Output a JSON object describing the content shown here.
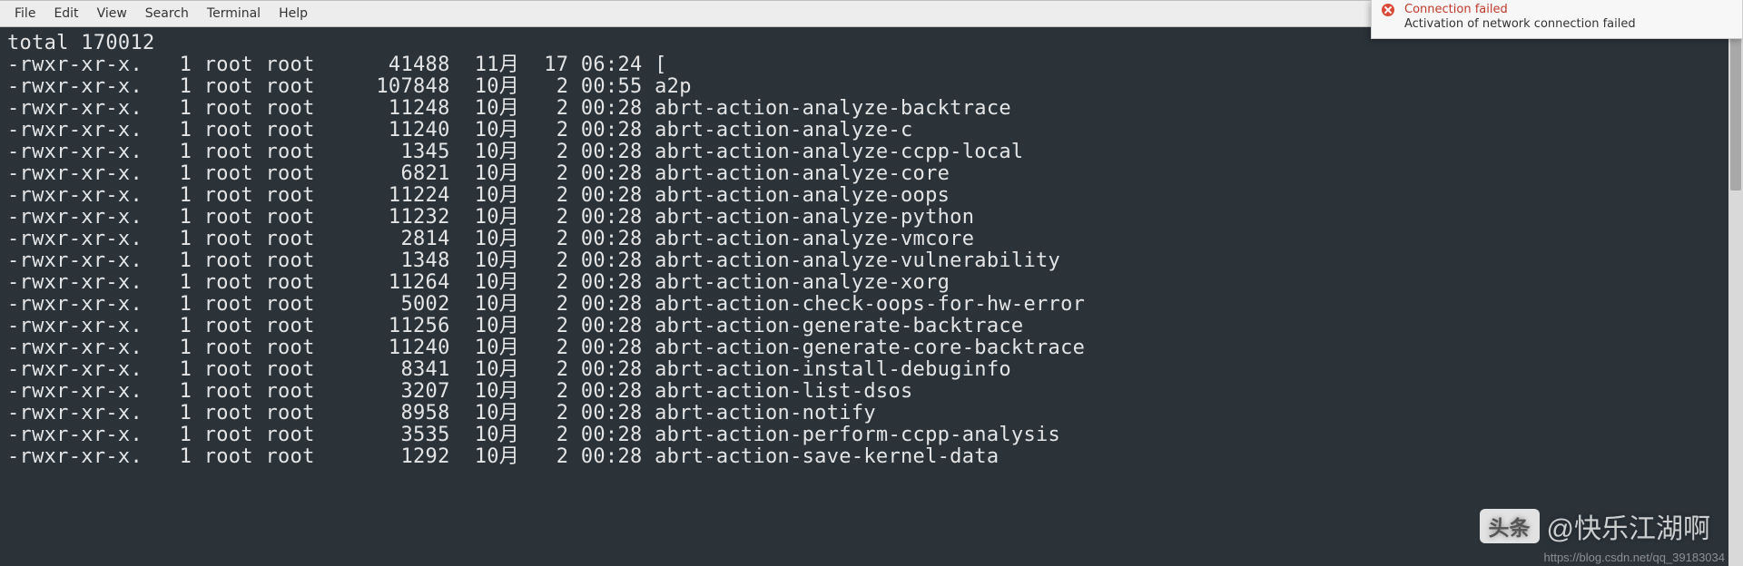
{
  "menu": {
    "items": [
      "File",
      "Edit",
      "View",
      "Search",
      "Terminal",
      "Help"
    ]
  },
  "notification": {
    "title": "Connection failed",
    "message": "Activation of network connection failed"
  },
  "terminal": {
    "total_line": "total 170012",
    "rows": [
      {
        "perm": "-rwxr-xr-x.",
        "links": "1",
        "owner": "root",
        "group": "root",
        "size": "41488",
        "month": "11月",
        "day": "17",
        "time": "06:24",
        "name": "["
      },
      {
        "perm": "-rwxr-xr-x.",
        "links": "1",
        "owner": "root",
        "group": "root",
        "size": "107848",
        "month": "10月",
        "day": "2",
        "time": "00:55",
        "name": "a2p"
      },
      {
        "perm": "-rwxr-xr-x.",
        "links": "1",
        "owner": "root",
        "group": "root",
        "size": "11248",
        "month": "10月",
        "day": "2",
        "time": "00:28",
        "name": "abrt-action-analyze-backtrace"
      },
      {
        "perm": "-rwxr-xr-x.",
        "links": "1",
        "owner": "root",
        "group": "root",
        "size": "11240",
        "month": "10月",
        "day": "2",
        "time": "00:28",
        "name": "abrt-action-analyze-c"
      },
      {
        "perm": "-rwxr-xr-x.",
        "links": "1",
        "owner": "root",
        "group": "root",
        "size": "1345",
        "month": "10月",
        "day": "2",
        "time": "00:28",
        "name": "abrt-action-analyze-ccpp-local"
      },
      {
        "perm": "-rwxr-xr-x.",
        "links": "1",
        "owner": "root",
        "group": "root",
        "size": "6821",
        "month": "10月",
        "day": "2",
        "time": "00:28",
        "name": "abrt-action-analyze-core"
      },
      {
        "perm": "-rwxr-xr-x.",
        "links": "1",
        "owner": "root",
        "group": "root",
        "size": "11224",
        "month": "10月",
        "day": "2",
        "time": "00:28",
        "name": "abrt-action-analyze-oops"
      },
      {
        "perm": "-rwxr-xr-x.",
        "links": "1",
        "owner": "root",
        "group": "root",
        "size": "11232",
        "month": "10月",
        "day": "2",
        "time": "00:28",
        "name": "abrt-action-analyze-python"
      },
      {
        "perm": "-rwxr-xr-x.",
        "links": "1",
        "owner": "root",
        "group": "root",
        "size": "2814",
        "month": "10月",
        "day": "2",
        "time": "00:28",
        "name": "abrt-action-analyze-vmcore"
      },
      {
        "perm": "-rwxr-xr-x.",
        "links": "1",
        "owner": "root",
        "group": "root",
        "size": "1348",
        "month": "10月",
        "day": "2",
        "time": "00:28",
        "name": "abrt-action-analyze-vulnerability"
      },
      {
        "perm": "-rwxr-xr-x.",
        "links": "1",
        "owner": "root",
        "group": "root",
        "size": "11264",
        "month": "10月",
        "day": "2",
        "time": "00:28",
        "name": "abrt-action-analyze-xorg"
      },
      {
        "perm": "-rwxr-xr-x.",
        "links": "1",
        "owner": "root",
        "group": "root",
        "size": "5002",
        "month": "10月",
        "day": "2",
        "time": "00:28",
        "name": "abrt-action-check-oops-for-hw-error"
      },
      {
        "perm": "-rwxr-xr-x.",
        "links": "1",
        "owner": "root",
        "group": "root",
        "size": "11256",
        "month": "10月",
        "day": "2",
        "time": "00:28",
        "name": "abrt-action-generate-backtrace"
      },
      {
        "perm": "-rwxr-xr-x.",
        "links": "1",
        "owner": "root",
        "group": "root",
        "size": "11240",
        "month": "10月",
        "day": "2",
        "time": "00:28",
        "name": "abrt-action-generate-core-backtrace"
      },
      {
        "perm": "-rwxr-xr-x.",
        "links": "1",
        "owner": "root",
        "group": "root",
        "size": "8341",
        "month": "10月",
        "day": "2",
        "time": "00:28",
        "name": "abrt-action-install-debuginfo"
      },
      {
        "perm": "-rwxr-xr-x.",
        "links": "1",
        "owner": "root",
        "group": "root",
        "size": "3207",
        "month": "10月",
        "day": "2",
        "time": "00:28",
        "name": "abrt-action-list-dsos"
      },
      {
        "perm": "-rwxr-xr-x.",
        "links": "1",
        "owner": "root",
        "group": "root",
        "size": "8958",
        "month": "10月",
        "day": "2",
        "time": "00:28",
        "name": "abrt-action-notify"
      },
      {
        "perm": "-rwxr-xr-x.",
        "links": "1",
        "owner": "root",
        "group": "root",
        "size": "3535",
        "month": "10月",
        "day": "2",
        "time": "00:28",
        "name": "abrt-action-perform-ccpp-analysis"
      },
      {
        "perm": "-rwxr-xr-x.",
        "links": "1",
        "owner": "root",
        "group": "root",
        "size": "1292",
        "month": "10月",
        "day": "2",
        "time": "00:28",
        "name": "abrt-action-save-kernel-data"
      }
    ]
  },
  "watermark": {
    "chip": "头条",
    "handle": "@快乐江湖啊",
    "url": "https://blog.csdn.net/qq_39183034"
  }
}
